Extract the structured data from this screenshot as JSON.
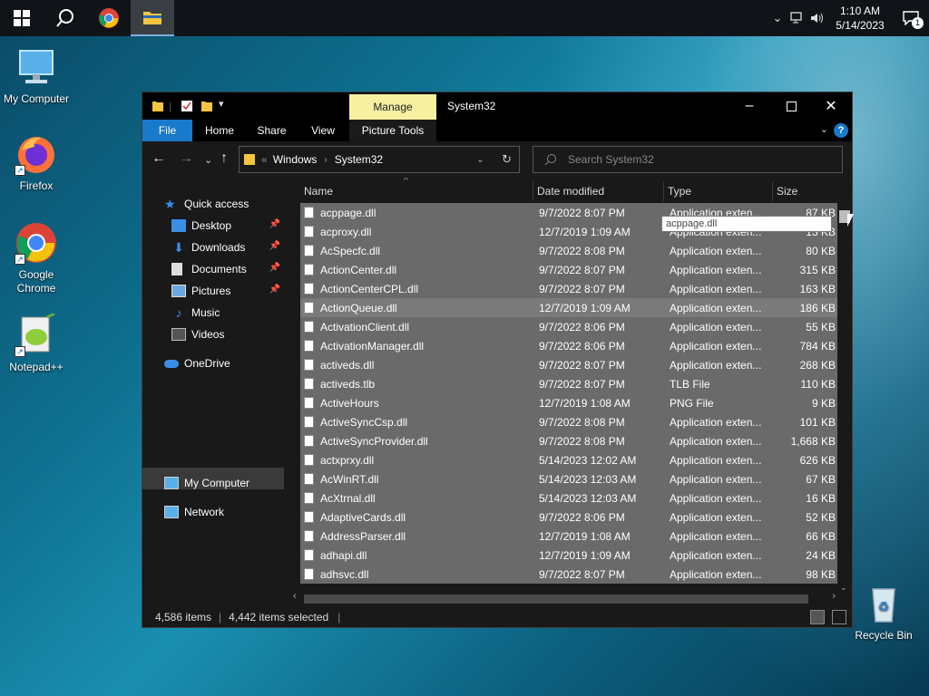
{
  "taskbar": {
    "clock_time": "1:10 AM",
    "clock_date": "5/14/2023",
    "notification_count": "1"
  },
  "desktop_icons": [
    {
      "label": "My Computer"
    },
    {
      "label": "Firefox"
    },
    {
      "label": "Google Chrome"
    },
    {
      "label": "Notepad++"
    },
    {
      "label": "Recycle Bin"
    }
  ],
  "window": {
    "title": "System32",
    "manage_tab": "Manage",
    "ribbon_tabs": [
      "File",
      "Home",
      "Share",
      "View",
      "Picture Tools"
    ],
    "breadcrumb": [
      "Windows",
      "System32"
    ],
    "breadcrumb_overflow": "«",
    "search_placeholder": "Search System32",
    "columns": [
      "Name",
      "Date modified",
      "Type",
      "Size"
    ],
    "tooltip": "acppage.dll",
    "status_items": "4,586 items",
    "status_selected": "4,442 items selected"
  },
  "sidebar": {
    "items": [
      {
        "label": "Quick access",
        "icon": "star-icon"
      },
      {
        "label": "Desktop",
        "icon": "desktop-icon",
        "pinned": true
      },
      {
        "label": "Downloads",
        "icon": "download-icon",
        "pinned": true
      },
      {
        "label": "Documents",
        "icon": "documents-icon",
        "pinned": true
      },
      {
        "label": "Pictures",
        "icon": "pictures-icon",
        "pinned": true
      },
      {
        "label": "Music",
        "icon": "music-icon"
      },
      {
        "label": "Videos",
        "icon": "videos-icon"
      },
      {
        "label": "OneDrive",
        "icon": "cloud-icon"
      },
      {
        "label": "My Computer",
        "icon": "computer-icon"
      },
      {
        "label": "Network",
        "icon": "network-icon"
      }
    ]
  },
  "files": [
    {
      "name": "acppage.dll",
      "date": "9/7/2022 8:07 PM",
      "type": "Application exten...",
      "size": "87 KB"
    },
    {
      "name": "acproxy.dll",
      "date": "12/7/2019 1:09 AM",
      "type": "Application exten...",
      "size": "13 KB"
    },
    {
      "name": "AcSpecfc.dll",
      "date": "9/7/2022 8:08 PM",
      "type": "Application exten...",
      "size": "80 KB"
    },
    {
      "name": "ActionCenter.dll",
      "date": "9/7/2022 8:07 PM",
      "type": "Application exten...",
      "size": "315 KB"
    },
    {
      "name": "ActionCenterCPL.dll",
      "date": "9/7/2022 8:07 PM",
      "type": "Application exten...",
      "size": "163 KB"
    },
    {
      "name": "ActionQueue.dll",
      "date": "12/7/2019 1:09 AM",
      "type": "Application exten...",
      "size": "186 KB"
    },
    {
      "name": "ActivationClient.dll",
      "date": "9/7/2022 8:06 PM",
      "type": "Application exten...",
      "size": "55 KB"
    },
    {
      "name": "ActivationManager.dll",
      "date": "9/7/2022 8:06 PM",
      "type": "Application exten...",
      "size": "784 KB"
    },
    {
      "name": "activeds.dll",
      "date": "9/7/2022 8:07 PM",
      "type": "Application exten...",
      "size": "268 KB"
    },
    {
      "name": "activeds.tlb",
      "date": "9/7/2022 8:07 PM",
      "type": "TLB File",
      "size": "110 KB"
    },
    {
      "name": "ActiveHours",
      "date": "12/7/2019 1:08 AM",
      "type": "PNG File",
      "size": "9 KB"
    },
    {
      "name": "ActiveSyncCsp.dll",
      "date": "9/7/2022 8:08 PM",
      "type": "Application exten...",
      "size": "101 KB"
    },
    {
      "name": "ActiveSyncProvider.dll",
      "date": "9/7/2022 8:08 PM",
      "type": "Application exten...",
      "size": "1,668 KB"
    },
    {
      "name": "actxprxy.dll",
      "date": "5/14/2023 12:02 AM",
      "type": "Application exten...",
      "size": "626 KB"
    },
    {
      "name": "AcWinRT.dll",
      "date": "5/14/2023 12:03 AM",
      "type": "Application exten...",
      "size": "67 KB"
    },
    {
      "name": "AcXtrnal.dll",
      "date": "5/14/2023 12:03 AM",
      "type": "Application exten...",
      "size": "16 KB"
    },
    {
      "name": "AdaptiveCards.dll",
      "date": "9/7/2022 8:06 PM",
      "type": "Application exten...",
      "size": "52 KB"
    },
    {
      "name": "AddressParser.dll",
      "date": "12/7/2019 1:08 AM",
      "type": "Application exten...",
      "size": "66 KB"
    },
    {
      "name": "adhapi.dll",
      "date": "12/7/2019 1:09 AM",
      "type": "Application exten...",
      "size": "24 KB"
    },
    {
      "name": "adhsvc.dll",
      "date": "9/7/2022 8:07 PM",
      "type": "Application exten...",
      "size": "98 KB"
    }
  ]
}
